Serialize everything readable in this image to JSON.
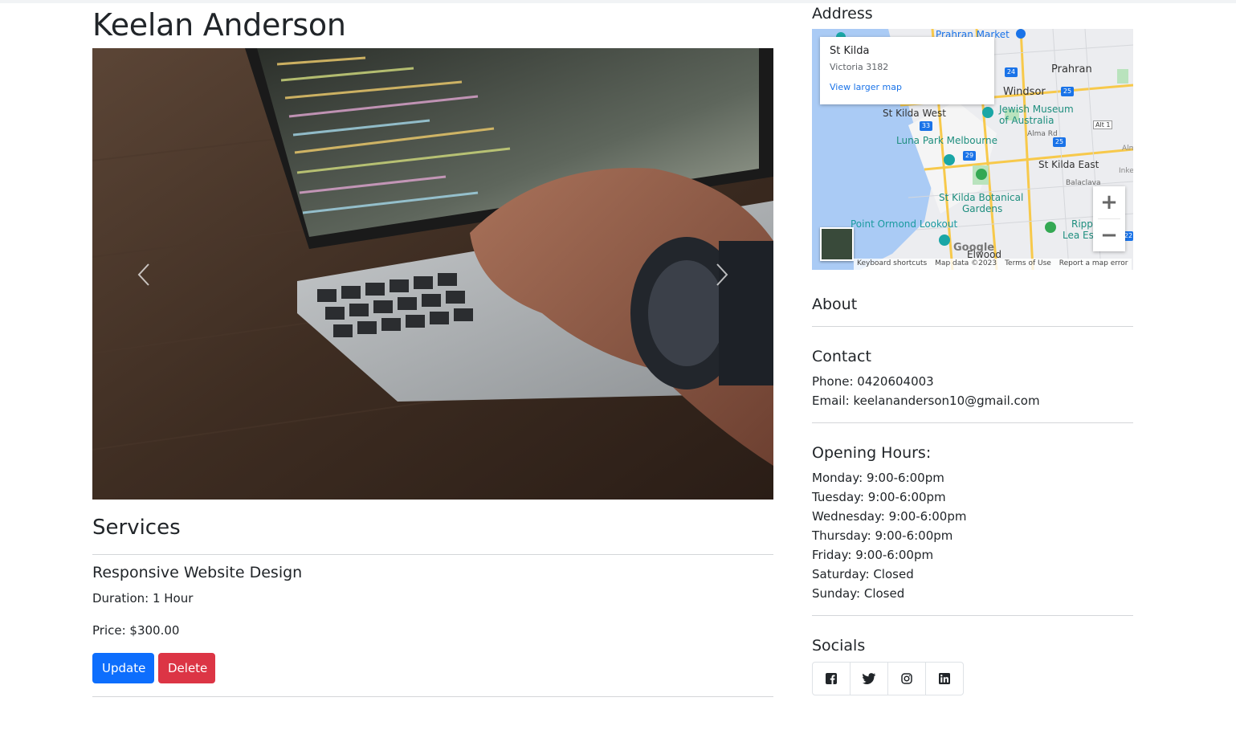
{
  "profile": {
    "name": "Keelan Anderson"
  },
  "carousel": {
    "prev_icon": "chevron-left-icon",
    "next_icon": "chevron-right-icon"
  },
  "services": {
    "title": "Services",
    "items": [
      {
        "name": "Responsive Website Design",
        "duration": "Duration: 1 Hour",
        "price": "Price: $300.00",
        "update_label": "Update",
        "delete_label": "Delete"
      }
    ]
  },
  "address": {
    "title": "Address",
    "map": {
      "place": "St Kilda",
      "locality": "Victoria 3182",
      "larger_map_link": "View larger map",
      "labels": [
        "Prahran Market",
        "Prahran",
        "Windsor",
        "Jewish Museum",
        "of Australia",
        "St Kilda West",
        "Luna Park Melbourne",
        "St Kilda East",
        "St Kilda Botanical",
        "Gardens",
        "Point Ormond Lookout",
        "Alma Rd",
        "Balaclava",
        "Ripp",
        "Lea Es",
        "Elwood",
        "Alt 1",
        "Inke",
        "Alm",
        "Google"
      ],
      "route_badges": [
        "24",
        "25",
        "33",
        "29",
        "25",
        "22"
      ],
      "attribution": [
        "Keyboard shortcuts",
        "Map data ©2023",
        "Terms of Use",
        "Report a map error"
      ],
      "zoom_in": "+",
      "zoom_out": "−"
    }
  },
  "about": {
    "title": "About"
  },
  "contact": {
    "title": "Contact",
    "phone": "Phone: 0420604003",
    "email": "Email: keelananderson10@gmail.com"
  },
  "hours": {
    "title": "Opening Hours:",
    "days": [
      "Monday: 9:00-6:00pm",
      "Tuesday: 9:00-6:00pm",
      "Wednesday: 9:00-6:00pm",
      "Thursday: 9:00-6:00pm",
      "Friday: 9:00-6:00pm",
      "Saturday: Closed",
      "Sunday: Closed"
    ]
  },
  "socials": {
    "title": "Socials",
    "icons": [
      "facebook-icon",
      "twitter-icon",
      "instagram-icon",
      "linkedin-icon"
    ]
  },
  "colors": {
    "primary": "#0d6efd",
    "danger": "#dc3545",
    "text": "#212529"
  }
}
